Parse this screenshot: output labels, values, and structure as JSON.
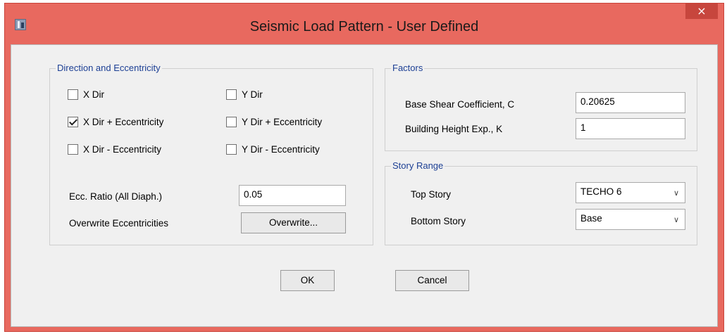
{
  "window": {
    "title": "Seismic Load Pattern - User Defined",
    "close_glyph": "×",
    "app_icon": "app-icon"
  },
  "direction": {
    "title": "Direction and Eccentricity",
    "checkboxes": [
      {
        "label": "X Dir",
        "checked": false
      },
      {
        "label": "Y Dir",
        "checked": false
      },
      {
        "label": "X Dir + Eccentricity",
        "checked": true
      },
      {
        "label": "Y Dir + Eccentricity",
        "checked": false
      },
      {
        "label": "X Dir - Eccentricity",
        "checked": false
      },
      {
        "label": "Y Dir - Eccentricity",
        "checked": false
      }
    ],
    "ecc_ratio_label": "Ecc. Ratio (All Diaph.)",
    "ecc_ratio_value": "0.05",
    "overwrite_label": "Overwrite Eccentricities",
    "overwrite_button": "Overwrite..."
  },
  "factors": {
    "title": "Factors",
    "base_shear_label": "Base Shear Coefficient, C",
    "base_shear_value": "0.20625",
    "height_exp_label": "Building Height Exp., K",
    "height_exp_value": "1"
  },
  "story_range": {
    "title": "Story Range",
    "top_label": "Top Story",
    "top_value": "TECHO 6",
    "bottom_label": "Bottom Story",
    "bottom_value": "Base",
    "dropdown_glyph": "∨"
  },
  "buttons": {
    "ok": "OK",
    "cancel": "Cancel"
  },
  "colors": {
    "frame": "#e8695f",
    "group_title": "#1c3f94",
    "client_bg": "#f0f0f0"
  }
}
